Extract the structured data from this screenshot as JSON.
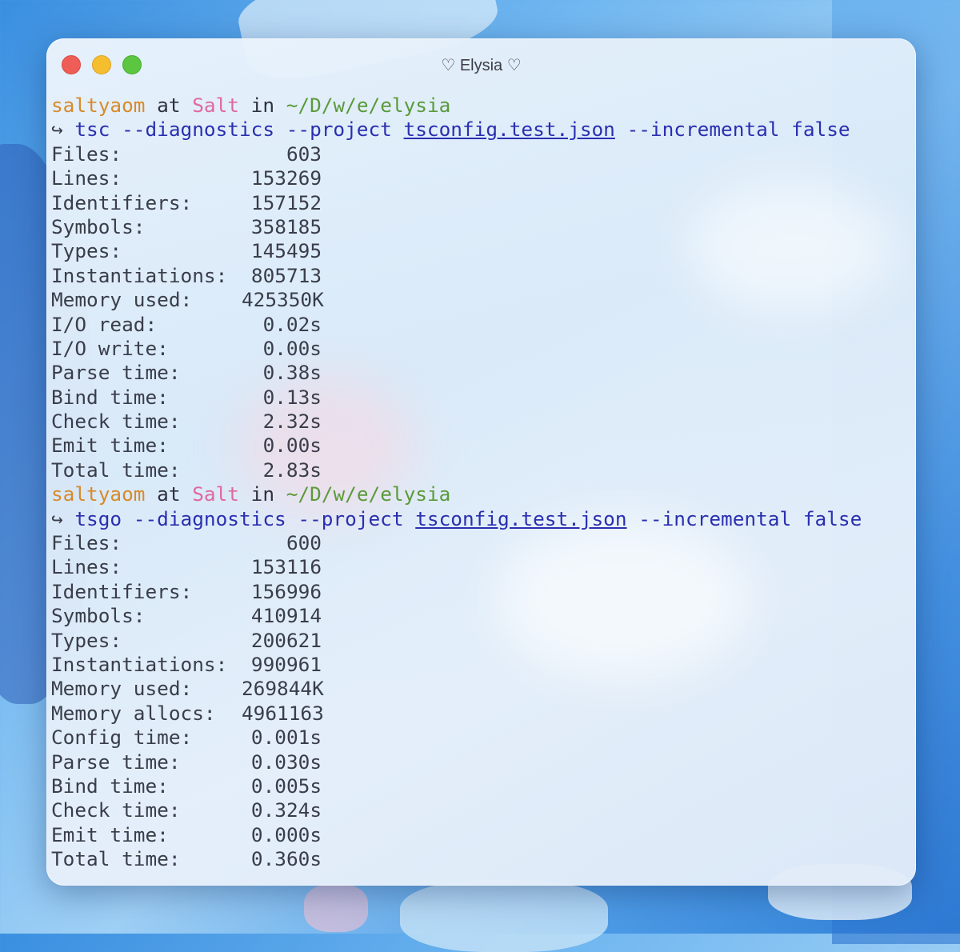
{
  "window": {
    "title": "♡ Elysia ♡"
  },
  "prompt": {
    "user": "saltyaom",
    "at": "at",
    "host": "Salt",
    "in": "in",
    "path": "~/D/w/e/elysia",
    "arrow": "↪"
  },
  "run1": {
    "command": "tsc --diagnostics --project",
    "file": "tsconfig.test.json",
    "flags": "--incremental false",
    "stats": [
      {
        "label": "Files:",
        "value": "603"
      },
      {
        "label": "Lines:",
        "value": "153269"
      },
      {
        "label": "Identifiers:",
        "value": "157152"
      },
      {
        "label": "Symbols:",
        "value": "358185"
      },
      {
        "label": "Types:",
        "value": "145495"
      },
      {
        "label": "Instantiations:",
        "value": "805713"
      },
      {
        "label": "Memory used:",
        "value": "425350K"
      },
      {
        "label": "I/O read:",
        "value": "0.02s"
      },
      {
        "label": "I/O write:",
        "value": "0.00s"
      },
      {
        "label": "Parse time:",
        "value": "0.38s"
      },
      {
        "label": "Bind time:",
        "value": "0.13s"
      },
      {
        "label": "Check time:",
        "value": "2.32s"
      },
      {
        "label": "Emit time:",
        "value": "0.00s"
      },
      {
        "label": "Total time:",
        "value": "2.83s"
      }
    ]
  },
  "run2": {
    "command": "tsgo --diagnostics --project",
    "file": "tsconfig.test.json",
    "flags": "--incremental false",
    "stats": [
      {
        "label": "Files:",
        "value": "600"
      },
      {
        "label": "Lines:",
        "value": "153116"
      },
      {
        "label": "Identifiers:",
        "value": "156996"
      },
      {
        "label": "Symbols:",
        "value": "410914"
      },
      {
        "label": "Types:",
        "value": "200621"
      },
      {
        "label": "Instantiations:",
        "value": "990961"
      },
      {
        "label": "Memory used:",
        "value": "269844K"
      },
      {
        "label": "Memory allocs:",
        "value": "4961163"
      },
      {
        "label": "Config time:",
        "value": "0.001s"
      },
      {
        "label": "Parse time:",
        "value": "0.030s"
      },
      {
        "label": "Bind time:",
        "value": "0.005s"
      },
      {
        "label": "Check time:",
        "value": "0.324s"
      },
      {
        "label": "Emit time:",
        "value": "0.000s"
      },
      {
        "label": "Total time:",
        "value": "0.360s"
      }
    ]
  },
  "colors": {
    "user": "#d88a2a",
    "host": "#e0689e",
    "path": "#5a9a3a",
    "command": "#2a2fb0"
  }
}
